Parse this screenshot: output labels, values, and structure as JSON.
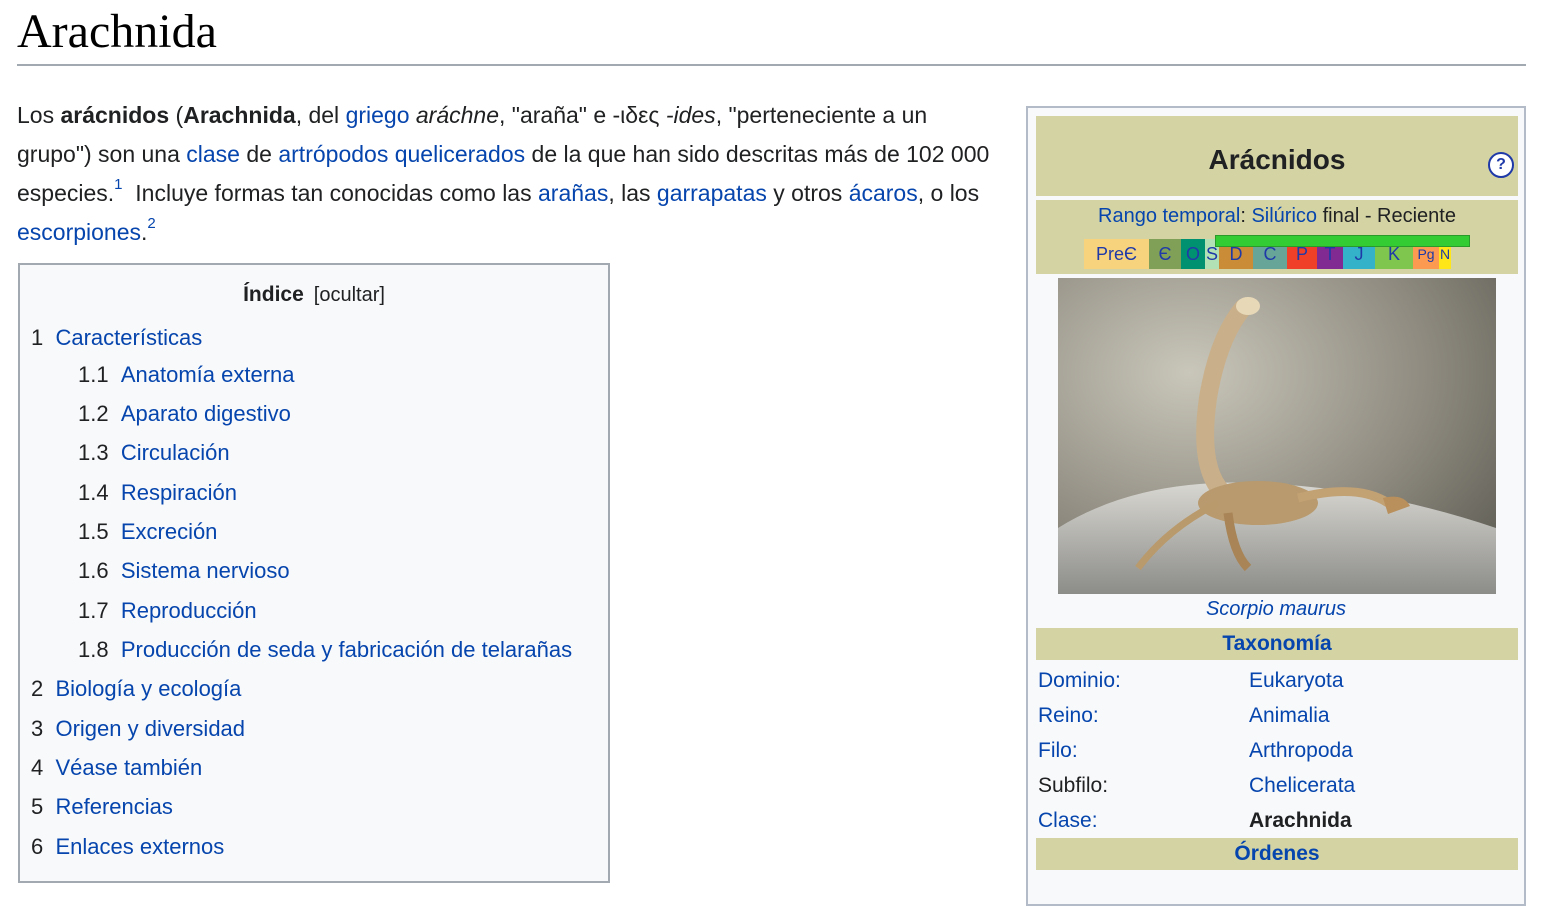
{
  "title": "Arachnida",
  "intro": {
    "t1": "Los ",
    "b1": "arácnidos",
    "t2": " (",
    "b2": "Arachnida",
    "t3": ", del ",
    "l_griego": "griego",
    "t4": " ",
    "i1": "aráchne",
    "t5": ", \"araña\" e -ιδες ",
    "i2": "-ides",
    "t6": ", \"perteneciente a un grupo\") son una ",
    "l_clase": "clase",
    "t7": " de ",
    "l_artropodos": "artrópodos",
    "t8": " ",
    "l_quelicerados": "quelicerados",
    "t9": " de la que han sido descritas más de 102 000 especies.",
    "ref1": "1",
    "t10": "  Incluye formas tan conocidas como las ",
    "l_aranas": "arañas",
    "t11": ", las ",
    "l_garrapatas": "garrapatas",
    "t12": " y otros ",
    "l_acaros": "ácaros",
    "t13": ", o los ",
    "l_escorpiones": "escorpiones",
    "t14": ".",
    "ref2": "2"
  },
  "toc": {
    "title": "Índice",
    "toggle": "[ocultar]",
    "items": [
      {
        "num": "1",
        "text": "Características"
      },
      {
        "num": "1.1",
        "text": "Anatomía externa"
      },
      {
        "num": "1.2",
        "text": "Aparato digestivo"
      },
      {
        "num": "1.3",
        "text": "Circulación"
      },
      {
        "num": "1.4",
        "text": "Respiración"
      },
      {
        "num": "1.5",
        "text": "Excreción"
      },
      {
        "num": "1.6",
        "text": "Sistema nervioso"
      },
      {
        "num": "1.7",
        "text": "Reproducción"
      },
      {
        "num": "1.8",
        "text": "Producción de seda y fabricación de telarañas"
      },
      {
        "num": "2",
        "text": "Biología y ecología"
      },
      {
        "num": "3",
        "text": "Origen y diversidad"
      },
      {
        "num": "4",
        "text": "Véase también"
      },
      {
        "num": "5",
        "text": "Referencias"
      },
      {
        "num": "6",
        "text": "Enlaces externos"
      }
    ]
  },
  "infobox": {
    "title": "Arácnidos",
    "help": "?",
    "range_label": "Rango temporal",
    "range_sep": ": ",
    "range_period": "Silúrico",
    "range_rest": " final - Reciente",
    "periods": [
      {
        "label": "PreЄ",
        "color": "#f7d37e"
      },
      {
        "label": "Є",
        "color": "#7fa056"
      },
      {
        "label": "O",
        "color": "#009270"
      },
      {
        "label": "S",
        "color": "#b3e1b6"
      },
      {
        "label": "D",
        "color": "#cb8c37"
      },
      {
        "label": "C",
        "color": "#67a599"
      },
      {
        "label": "P",
        "color": "#f04028"
      },
      {
        "label": "T",
        "color": "#812b92"
      },
      {
        "label": "J",
        "color": "#34b2c9"
      },
      {
        "label": "K",
        "color": "#7fc64e"
      },
      {
        "label": "Pg",
        "color": "#fd9a52"
      },
      {
        "label": "N",
        "color": "#ffe619"
      }
    ],
    "caption": "Scorpio maurus",
    "taxonomy_header": "Taxonomía",
    "rows": [
      {
        "key": "Dominio:",
        "value": "Eukaryota"
      },
      {
        "key": "Reino:",
        "value": "Animalia"
      },
      {
        "key": "Filo:",
        "value": "Arthropoda"
      },
      {
        "key": "Subfilo:",
        "value": "Chelicerata"
      },
      {
        "key": "Clase:",
        "value": "Arachnida"
      }
    ],
    "orders_header": "Órdenes"
  }
}
